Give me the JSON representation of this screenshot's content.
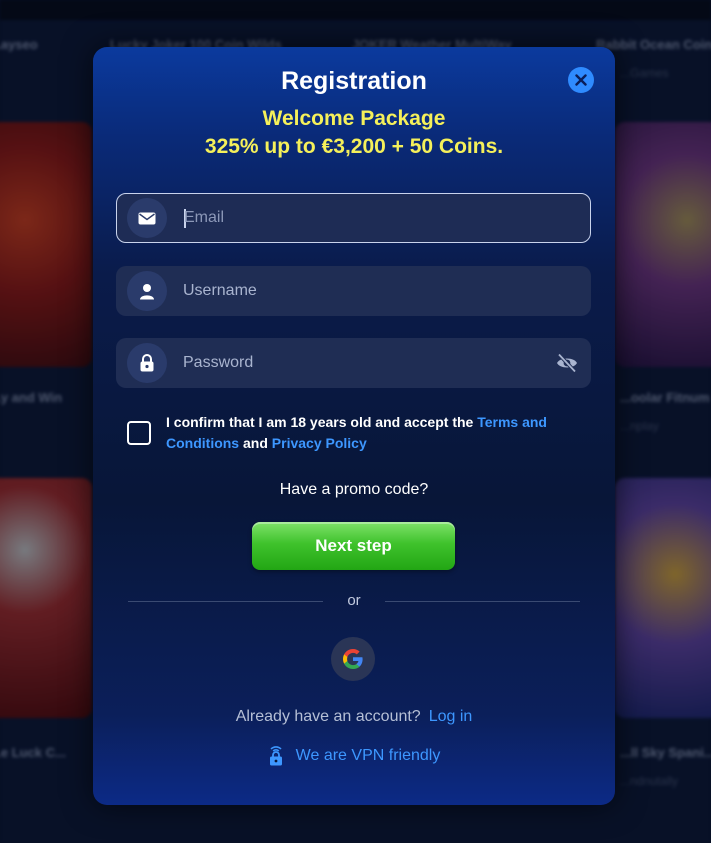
{
  "background": {
    "tiles": [
      {
        "title": "...ayseo",
        "sub": ""
      },
      {
        "title": "Lucky Joker 100 Coin Wilds",
        "sub": ""
      },
      {
        "title": "JOKER Weather MultiWay",
        "sub": ""
      },
      {
        "title": "Rabbit Ocean Coins",
        "sub": "...Games"
      },
      {
        "title": "...y and Win",
        "sub": ""
      },
      {
        "title": "...oolar Fitnum Vol...",
        "sub": "...nplay"
      },
      {
        "title": "...e Luck C...",
        "sub": ""
      },
      {
        "title": "...ll Sky Spani...",
        "sub": "...ndnutally"
      }
    ]
  },
  "modal": {
    "title": "Registration",
    "promo_line1": "Welcome Package",
    "promo_line2": "325% up to €3,200 + 50 Coins.",
    "email": {
      "value": "",
      "placeholder": "Email"
    },
    "username": {
      "value": "",
      "placeholder": "Username"
    },
    "password": {
      "value": "",
      "placeholder": "Password"
    },
    "consent": {
      "text_before": "I confirm that I am 18 years old and accept the ",
      "terms_link": "Terms and Conditions",
      "text_and": " and ",
      "privacy_link": "Privacy Policy",
      "checked": false
    },
    "promo_code_label": "Have a promo code?",
    "next_button": "Next step",
    "divider_text": "or",
    "social": {
      "provider_icon": "google-icon"
    },
    "login_prompt": "Already have an account?",
    "login_link": "Log in",
    "vpn_text": "We are VPN friendly"
  },
  "colors": {
    "accent_blue": "#3d97ff",
    "promo_yellow": "#f5f05a",
    "button_green": "#3fc22c"
  }
}
